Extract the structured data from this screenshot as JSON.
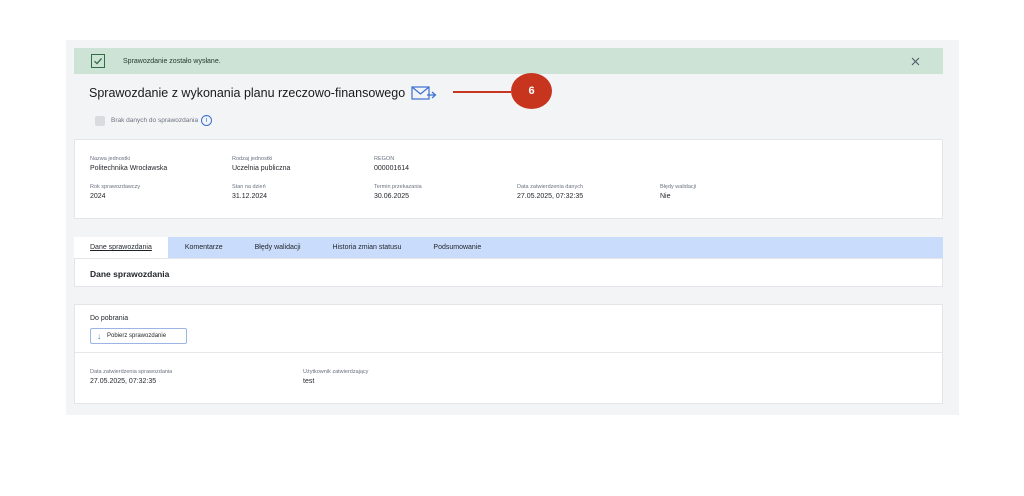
{
  "alert": {
    "message": "Sprawozdanie zostało wysłane.",
    "check_icon": "check-icon",
    "close_icon": "close-icon"
  },
  "header": {
    "title": "Sprawozdanie z wykonania planu rzeczowo-finansowego",
    "send_icon": "envelope-send-icon"
  },
  "annotation": {
    "number": "6"
  },
  "no_data": {
    "label": "Brak danych do sprawozdania",
    "info_icon": "i"
  },
  "details": {
    "nazwa_label": "Nazwa jednostki",
    "nazwa_value": "Politechnika Wrocławska",
    "rodzaj_label": "Rodzaj jednostki",
    "rodzaj_value": "Uczelnia publiczna",
    "regon_label": "REGON",
    "regon_value": "000001614",
    "rok_label": "Rok sprawozdawczy",
    "rok_value": "2024",
    "stan_label": "Stan na dzień",
    "stan_value": "31.12.2024",
    "termin_label": "Termin przekazania",
    "termin_value": "30.06.2025",
    "data_zatw_label": "Data zatwierdzenia danych",
    "data_zatw_value": "27.05.2025, 07:32:35",
    "bledy_label": "Błędy walidacji",
    "bledy_value": "Nie"
  },
  "tabs": [
    "Dane sprawozdania",
    "Komentarze",
    "Błędy walidacji",
    "Historia zmian statusu",
    "Podsumowanie"
  ],
  "section": {
    "title": "Dane sprawozdania"
  },
  "download": {
    "heading": "Do pobrania",
    "button_label": "Pobierz sprawozdanie",
    "date_label": "Data zatwierdzenia sprawozdania",
    "date_value": "27.05.2025, 07:32:35",
    "user_label": "Użytkownik zatwierdzający",
    "user_value": "test"
  },
  "colors": {
    "accent": "#3b6fd1",
    "success_bg": "#cde3d6",
    "tabs_bg": "#c9dcfb",
    "annotation": "#c8351f"
  }
}
